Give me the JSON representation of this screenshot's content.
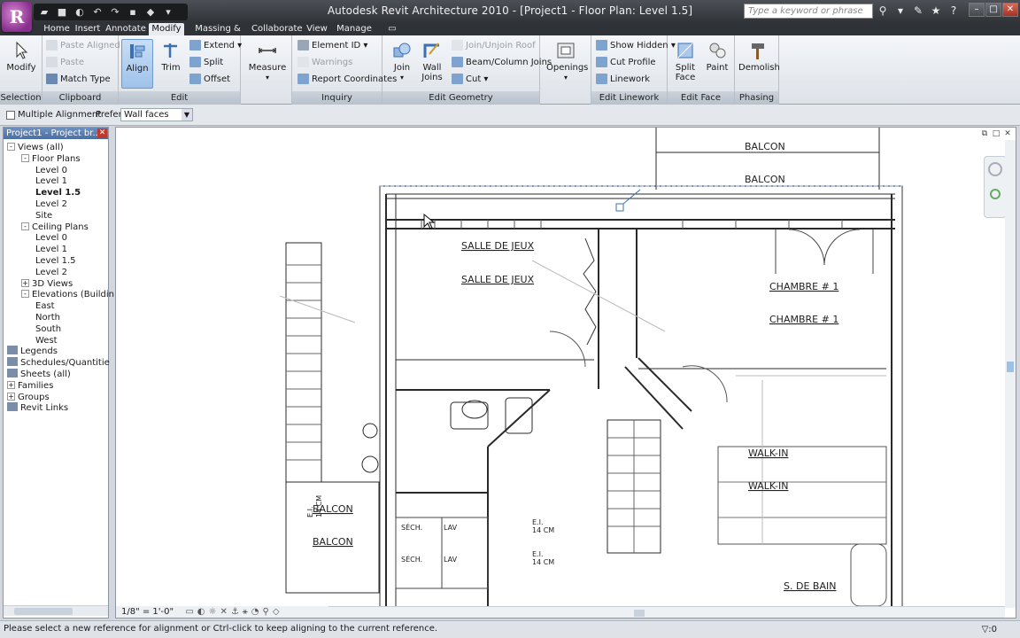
{
  "app": {
    "logo_letter": "R",
    "title": "Autodesk Revit Architecture 2010 - [Project1 - Floor Plan: Level 1.5]",
    "search_placeholder": "Type a keyword or phrase",
    "quick_access": [
      "R",
      "open-icon",
      "save-icon",
      "undo-icon",
      "redo-icon",
      "print-icon"
    ]
  },
  "tabs": [
    "Home",
    "Insert",
    "Annotate",
    "Modify",
    "Massing & Site",
    "Collaborate",
    "View",
    "Manage"
  ],
  "active_tab": "Modify",
  "ribbon": {
    "selection": {
      "label": "Selection",
      "modify": "Modify"
    },
    "clipboard": {
      "label": "Clipboard",
      "paste_aligned": "Paste Aligned",
      "paste": "Paste",
      "match_type": "Match Type"
    },
    "edit": {
      "label": "Edit",
      "align": "Align",
      "trim": "Trim",
      "extend": "Extend",
      "split": "Split",
      "offset": "Offset"
    },
    "measure": {
      "label": "Measure"
    },
    "inquiry": {
      "label": "Inquiry",
      "element_id": "Element ID",
      "warnings": "Warnings",
      "report_coordinates": "Report Coordinates"
    },
    "edit_geometry": {
      "label": "Edit Geometry",
      "join": "Join",
      "wall_joins": "Wall Joins",
      "join_unjoin_roof": "Join/Unjoin Roof",
      "beam_column_joins": "Beam/Column Joins",
      "cut": "Cut"
    },
    "openings": {
      "label": "Openings"
    },
    "edit_linework": {
      "label": "Edit Linework",
      "show_hidden": "Show Hidden",
      "cut_profile": "Cut Profile",
      "linework": "Linework"
    },
    "edit_face": {
      "label": "Edit Face",
      "split_face": "Split Face",
      "paint": "Paint"
    },
    "phasing": {
      "label": "Phasing",
      "demolish": "Demolish"
    }
  },
  "options_bar": {
    "multiple_alignment": "Multiple Alignment",
    "prefer_label": "Prefer:",
    "prefer_value": "Wall faces"
  },
  "project_browser": {
    "title": "Project1 - Project br...",
    "items": [
      {
        "label": "Views (all)",
        "level": 0,
        "toggle": "-"
      },
      {
        "label": "Floor Plans",
        "level": 1,
        "toggle": "-"
      },
      {
        "label": "Level 0",
        "level": 2,
        "toggle": ""
      },
      {
        "label": "Level 1",
        "level": 2,
        "toggle": ""
      },
      {
        "label": "Level 1.5",
        "level": 2,
        "toggle": "",
        "bold": true
      },
      {
        "label": "Level 2",
        "level": 2,
        "toggle": ""
      },
      {
        "label": "Site",
        "level": 2,
        "toggle": ""
      },
      {
        "label": "Ceiling Plans",
        "level": 1,
        "toggle": "-"
      },
      {
        "label": "Level 0",
        "level": 2,
        "toggle": ""
      },
      {
        "label": "Level 1",
        "level": 2,
        "toggle": ""
      },
      {
        "label": "Level 1.5",
        "level": 2,
        "toggle": ""
      },
      {
        "label": "Level 2",
        "level": 2,
        "toggle": ""
      },
      {
        "label": "3D Views",
        "level": 1,
        "toggle": "+"
      },
      {
        "label": "Elevations (Buildin",
        "level": 1,
        "toggle": "-"
      },
      {
        "label": "East",
        "level": 2,
        "toggle": ""
      },
      {
        "label": "North",
        "level": 2,
        "toggle": ""
      },
      {
        "label": "South",
        "level": 2,
        "toggle": ""
      },
      {
        "label": "West",
        "level": 2,
        "toggle": ""
      },
      {
        "label": "Legends",
        "level": 0,
        "toggle": ""
      },
      {
        "label": "Schedules/Quantitie",
        "level": 0,
        "toggle": ""
      },
      {
        "label": "Sheets (all)",
        "level": 0,
        "toggle": ""
      },
      {
        "label": "Families",
        "level": 0,
        "toggle": "+"
      },
      {
        "label": "Groups",
        "level": 0,
        "toggle": "+"
      },
      {
        "label": "Revit Links",
        "level": 0,
        "toggle": ""
      }
    ]
  },
  "drawing": {
    "rooms": {
      "balcon_top_1": "BALCON",
      "balcon_top_2": "BALCON",
      "salle_1": "SALLE DE JEUX",
      "salle_2": "SALLE DE JEUX",
      "chambre_1": "CHAMBRE # 1",
      "chambre_2": "CHAMBRE # 1",
      "walkin_1": "WALK-IN",
      "walkin_2": "WALK-IN",
      "balcon_left_1": "BALCON",
      "balcon_left_2": "BALCON",
      "sech_1": "SÉCH.",
      "lav_1": "LAV",
      "sech_2": "SÉCH.",
      "lav_2": "LAV",
      "sdebain": "S. DE BAIN",
      "ent_1": "E.I.",
      "ent_2": "E.I.",
      "ent_3": "E.I.",
      "dim_1": "14 CM",
      "dim_2": "14 CM",
      "dim_3": "14 CM"
    }
  },
  "view_bar": {
    "scale": "1/8\" = 1'-0\""
  },
  "status_bar": {
    "message": "Please select a new reference for alignment or Ctrl-click to keep aligning to the current reference.",
    "filter_count": ":0"
  }
}
